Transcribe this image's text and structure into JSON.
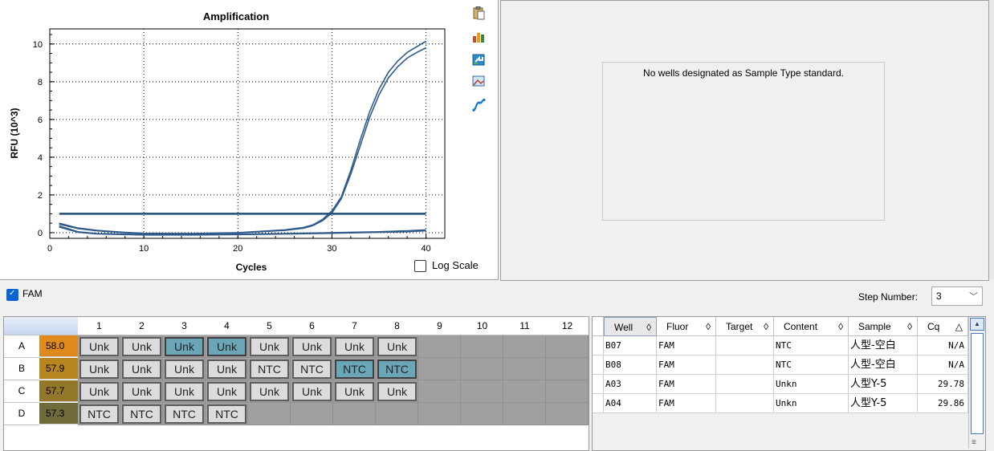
{
  "chart": {
    "title": "Amplification",
    "xlabel": "Cycles",
    "ylabel": "RFU (10^3)",
    "log_scale_label": "Log Scale",
    "log_scale_checked": false
  },
  "chart_data": {
    "type": "line",
    "title": "Amplification",
    "xlabel": "Cycles",
    "ylabel": "RFU (10^3)",
    "xlim": [
      0,
      42
    ],
    "ylim": [
      -0.3,
      10.8
    ],
    "xticks": [
      0,
      10,
      20,
      30,
      40
    ],
    "yticks": [
      0,
      2,
      4,
      6,
      8,
      10
    ],
    "grid": true,
    "legend": "none",
    "threshold": 1.0,
    "series": [
      {
        "x": [
          1,
          3,
          5,
          8,
          10,
          15,
          20,
          25,
          27,
          28,
          29,
          30,
          31,
          32,
          33,
          34,
          35,
          36,
          37,
          38,
          39,
          40
        ],
        "values": [
          0.5,
          0.25,
          0.12,
          0.02,
          -0.03,
          -0.05,
          0.0,
          0.15,
          0.28,
          0.42,
          0.7,
          1.15,
          1.9,
          3.3,
          4.9,
          6.4,
          7.6,
          8.5,
          9.1,
          9.55,
          9.85,
          10.15
        ]
      },
      {
        "x": [
          1,
          3,
          5,
          8,
          10,
          15,
          20,
          25,
          27,
          28,
          29,
          30,
          31,
          32,
          33,
          34,
          35,
          36,
          37,
          38,
          39,
          40
        ],
        "values": [
          0.45,
          0.22,
          0.1,
          0.0,
          -0.04,
          -0.05,
          -0.01,
          0.12,
          0.24,
          0.38,
          0.64,
          1.05,
          1.8,
          3.1,
          4.6,
          6.1,
          7.3,
          8.2,
          8.8,
          9.25,
          9.55,
          9.8
        ]
      },
      {
        "x": [
          1,
          3,
          5,
          8,
          10,
          15,
          20,
          25,
          30,
          35,
          38,
          40
        ],
        "values": [
          0.35,
          0.05,
          -0.05,
          -0.08,
          -0.1,
          -0.1,
          -0.08,
          -0.05,
          0.0,
          0.05,
          0.1,
          0.15
        ]
      },
      {
        "x": [
          1,
          3,
          5,
          8,
          10,
          15,
          20,
          25,
          30,
          35,
          38,
          40
        ],
        "values": [
          0.3,
          0.02,
          -0.06,
          -0.1,
          -0.12,
          -0.12,
          -0.1,
          -0.07,
          -0.03,
          0.02,
          0.05,
          0.1
        ]
      }
    ],
    "line_color": "#2f5a8a",
    "threshold_color": "#1b4f7f"
  },
  "standard": {
    "message": "No wells designated as Sample Type standard."
  },
  "fluor": {
    "label": "FAM",
    "checked": true,
    "step_label": "Step Number:",
    "step_value": "3"
  },
  "plate": {
    "columns": [
      "1",
      "2",
      "3",
      "4",
      "5",
      "6",
      "7",
      "8",
      "9",
      "10",
      "11",
      "12"
    ],
    "rows": [
      {
        "label": "A",
        "temp": "58.0",
        "temp_color": "#e08a1e",
        "wells": [
          {
            "t": "Unk",
            "sel": false
          },
          {
            "t": "Unk",
            "sel": false
          },
          {
            "t": "Unk",
            "sel": true
          },
          {
            "t": "Unk",
            "sel": true
          },
          {
            "t": "Unk",
            "sel": false
          },
          {
            "t": "Unk",
            "sel": false
          },
          {
            "t": "Unk",
            "sel": false
          },
          {
            "t": "Unk",
            "sel": false
          }
        ]
      },
      {
        "label": "B",
        "temp": "57.9",
        "temp_color": "#b8861e",
        "wells": [
          {
            "t": "Unk",
            "sel": false
          },
          {
            "t": "Unk",
            "sel": false
          },
          {
            "t": "Unk",
            "sel": false
          },
          {
            "t": "Unk",
            "sel": false
          },
          {
            "t": "NTC",
            "sel": false
          },
          {
            "t": "NTC",
            "sel": false
          },
          {
            "t": "NTC",
            "sel": true
          },
          {
            "t": "NTC",
            "sel": true
          }
        ]
      },
      {
        "label": "C",
        "temp": "57.7",
        "temp_color": "#94782a",
        "wells": [
          {
            "t": "Unk",
            "sel": false
          },
          {
            "t": "Unk",
            "sel": false
          },
          {
            "t": "Unk",
            "sel": false
          },
          {
            "t": "Unk",
            "sel": false
          },
          {
            "t": "Unk",
            "sel": false
          },
          {
            "t": "Unk",
            "sel": false
          },
          {
            "t": "Unk",
            "sel": false
          },
          {
            "t": "Unk",
            "sel": false
          }
        ]
      },
      {
        "label": "D",
        "temp": "57.3",
        "temp_color": "#6f6b3a",
        "wells": [
          {
            "t": "NTC",
            "sel": false
          },
          {
            "t": "NTC",
            "sel": false
          },
          {
            "t": "NTC",
            "sel": false
          },
          {
            "t": "NTC",
            "sel": false
          }
        ]
      }
    ]
  },
  "results": {
    "headers": [
      "Well",
      "Fluor",
      "Target",
      "Content",
      "Sample",
      "Cq"
    ],
    "sort_glyph": "◊",
    "cq_sort_glyph": "△",
    "rows": [
      {
        "well": "B07",
        "fluor": "FAM",
        "target": "",
        "content": "NTC",
        "sample": "人型-空白",
        "cq": "N/A"
      },
      {
        "well": "B08",
        "fluor": "FAM",
        "target": "",
        "content": "NTC",
        "sample": "人型-空白",
        "cq": "N/A"
      },
      {
        "well": "A03",
        "fluor": "FAM",
        "target": "",
        "content": "Unkn",
        "sample": "人型Y-5",
        "cq": "29.78"
      },
      {
        "well": "A04",
        "fluor": "FAM",
        "target": "",
        "content": "Unkn",
        "sample": "人型Y-5",
        "cq": "29.86"
      }
    ]
  },
  "icons": [
    "clipboard-icon",
    "chart-settings-icon",
    "export-icon",
    "image-icon",
    "curve-icon"
  ]
}
